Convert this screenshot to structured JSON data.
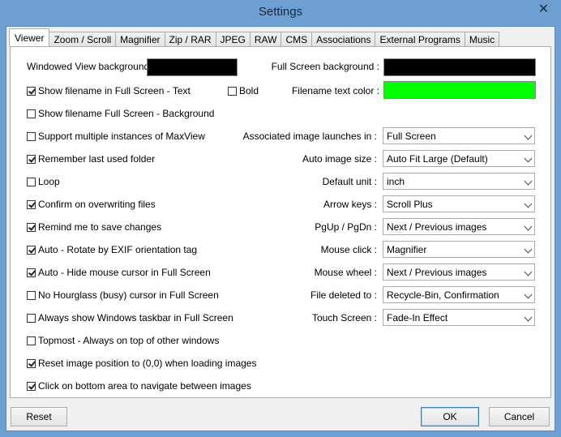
{
  "window": {
    "title": "Settings",
    "close_glyph": "✕"
  },
  "tabs": [
    "Viewer",
    "Zoom / Scroll",
    "Magnifier",
    "Zip / RAR",
    "JPEG",
    "RAW",
    "CMS",
    "Associations",
    "External Programs",
    "Music"
  ],
  "colors": {
    "windowed_bg": "#000000",
    "fullscreen_bg": "#000000",
    "filename_text": "#00ff00"
  },
  "labels": {
    "windowed_bg": "Windowed View background :",
    "fullscreen_bg": "Full Screen background :",
    "filename_color": "Filename text color :",
    "bold": "Bold"
  },
  "checkboxes": [
    {
      "label": "Show filename in Full Screen - Text",
      "checked": true
    },
    {
      "label": "Show filename Full Screen - Background",
      "checked": false
    },
    {
      "label": "Support multiple instances of MaxView",
      "checked": false
    },
    {
      "label": "Remember last used folder",
      "checked": true
    },
    {
      "label": "Loop",
      "checked": false
    },
    {
      "label": "Confirm on overwriting files",
      "checked": true
    },
    {
      "label": "Remind me to save changes",
      "checked": true
    },
    {
      "label": "Auto - Rotate by EXIF orientation tag",
      "checked": true
    },
    {
      "label": "Auto - Hide mouse cursor in Full Screen",
      "checked": true
    },
    {
      "label": "No Hourglass (busy) cursor in Full Screen",
      "checked": false
    },
    {
      "label": "Always show Windows taskbar in Full Screen",
      "checked": false
    },
    {
      "label": "Topmost - Always on top of other windows",
      "checked": false
    },
    {
      "label": "Reset image position to (0,0) when loading images",
      "checked": true
    },
    {
      "label": "Click on bottom area to navigate between images",
      "checked": true
    }
  ],
  "bold_checked": false,
  "dropdowns": [
    {
      "label": "Associated image launches in :",
      "value": "Full Screen"
    },
    {
      "label": "Auto image size :",
      "value": "Auto Fit Large (Default)"
    },
    {
      "label": "Default unit :",
      "value": "inch"
    },
    {
      "label": "Arrow keys :",
      "value": "Scroll Plus"
    },
    {
      "label": "PgUp / PgDn :",
      "value": "Next / Previous images"
    },
    {
      "label": "Mouse click :",
      "value": "Magnifier"
    },
    {
      "label": "Mouse wheel :",
      "value": "Next / Previous images"
    },
    {
      "label": "File deleted to :",
      "value": "Recycle-Bin, Confirmation"
    },
    {
      "label": "Touch Screen :",
      "value": "Fade-In Effect"
    }
  ],
  "buttons": {
    "reset": "Reset",
    "ok": "OK",
    "cancel": "Cancel"
  }
}
